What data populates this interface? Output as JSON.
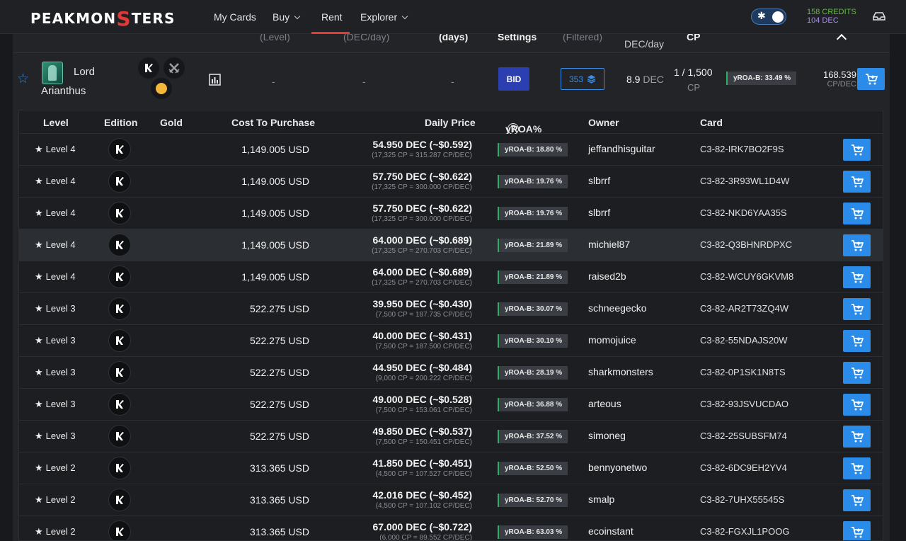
{
  "nav": {
    "logo_prefix": "PEAKMON",
    "logo_s": "S",
    "logo_suffix": "TERS",
    "items": {
      "my_cards": "My Cards",
      "buy": "Buy",
      "rent": "Rent",
      "explorer": "Explorer"
    },
    "active": "Rent",
    "credits": "158 CREDITS",
    "dec": "104 DEC",
    "accent_color": "#e53935"
  },
  "card_header": {
    "level": "(Level)",
    "dec_day": "(DEC/day)",
    "days": "(days)",
    "settings": "Settings",
    "filtered": "(Filtered)",
    "price_unit": "DEC/day",
    "cp": "CP"
  },
  "card": {
    "name_line1": "Lord",
    "name_line2": "Arianthus",
    "dash1": "-",
    "dash2": "-",
    "dash3": "-",
    "bid_label": "BID",
    "filtered_count": "353",
    "price_value": "8.9",
    "price_unit": "DEC",
    "cp_value": "1 / 1,500",
    "cp_unit": "CP",
    "yroa": "yROA-B: 33.49 %",
    "cp_dec_value": "168.539",
    "cp_dec_unit": "CP/DEC"
  },
  "table": {
    "headers": {
      "level": "Level",
      "edition": "Edition",
      "gold": "Gold",
      "cost": "Cost To Purchase",
      "daily_price": "Daily Price",
      "yroa": "yROA%",
      "yroa_help": "?",
      "owner": "Owner",
      "card": "Card"
    },
    "rows": [
      {
        "level": "Level 4",
        "cost": "1,149.005 USD",
        "price": "54.950 DEC (~$0.592)",
        "price_sub": "(17,325 CP = 315.287 CP/DEC)",
        "yroa": "yROA-B: 18.80 %",
        "owner": "jeffandhisguitar",
        "card": "C3-82-IRK7BO2F9S"
      },
      {
        "level": "Level 4",
        "cost": "1,149.005 USD",
        "price": "57.750 DEC (~$0.622)",
        "price_sub": "(17,325 CP = 300.000 CP/DEC)",
        "yroa": "yROA-B: 19.76 %",
        "owner": "slbrrf",
        "card": "C3-82-3R93WL1D4W"
      },
      {
        "level": "Level 4",
        "cost": "1,149.005 USD",
        "price": "57.750 DEC (~$0.622)",
        "price_sub": "(17,325 CP = 300.000 CP/DEC)",
        "yroa": "yROA-B: 19.76 %",
        "owner": "slbrrf",
        "card": "C3-82-NKD6YAA35S"
      },
      {
        "level": "Level 4",
        "cost": "1,149.005 USD",
        "price": "64.000 DEC (~$0.689)",
        "price_sub": "(17,325 CP = 270.703 CP/DEC)",
        "yroa": "yROA-B: 21.89 %",
        "owner": "michiel87",
        "card": "C3-82-Q3BHNRDPXC"
      },
      {
        "level": "Level 4",
        "cost": "1,149.005 USD",
        "price": "64.000 DEC (~$0.689)",
        "price_sub": "(17,325 CP = 270.703 CP/DEC)",
        "yroa": "yROA-B: 21.89 %",
        "owner": "raised2b",
        "card": "C3-82-WCUY6GKVM8"
      },
      {
        "level": "Level 3",
        "cost": "522.275 USD",
        "price": "39.950 DEC (~$0.430)",
        "price_sub": "(7,500 CP = 187.735 CP/DEC)",
        "yroa": "yROA-B: 30.07 %",
        "owner": "schneegecko",
        "card": "C3-82-AR2T73ZQ4W"
      },
      {
        "level": "Level 3",
        "cost": "522.275 USD",
        "price": "40.000 DEC (~$0.431)",
        "price_sub": "(7,500 CP = 187.500 CP/DEC)",
        "yroa": "yROA-B: 30.10 %",
        "owner": "momojuice",
        "card": "C3-82-55NDAJS20W"
      },
      {
        "level": "Level 3",
        "cost": "522.275 USD",
        "price": "44.950 DEC (~$0.484)",
        "price_sub": "(9,000 CP = 200.222 CP/DEC)",
        "yroa": "yROA-B: 28.19 %",
        "owner": "sharkmonsters",
        "card": "C3-82-0P1SK1N8TS"
      },
      {
        "level": "Level 3",
        "cost": "522.275 USD",
        "price": "49.000 DEC (~$0.528)",
        "price_sub": "(7,500 CP = 153.061 CP/DEC)",
        "yroa": "yROA-B: 36.88 %",
        "owner": "arteous",
        "card": "C3-82-93JSVUCDAO"
      },
      {
        "level": "Level 3",
        "cost": "522.275 USD",
        "price": "49.850 DEC (~$0.537)",
        "price_sub": "(7,500 CP = 150.451 CP/DEC)",
        "yroa": "yROA-B: 37.52 %",
        "owner": "simoneg",
        "card": "C3-82-25SUBSFM74"
      },
      {
        "level": "Level 2",
        "cost": "313.365 USD",
        "price": "41.850 DEC (~$0.451)",
        "price_sub": "(4,500 CP = 107.527 CP/DEC)",
        "yroa": "yROA-B: 52.50 %",
        "owner": "bennyonetwo",
        "card": "C3-82-6DC9EH2YV4"
      },
      {
        "level": "Level 2",
        "cost": "313.365 USD",
        "price": "42.016 DEC (~$0.452)",
        "price_sub": "(4,500 CP = 107.102 CP/DEC)",
        "yroa": "yROA-B: 52.70 %",
        "owner": "smalp",
        "card": "C3-82-7UHX55545S"
      },
      {
        "level": "Level 2",
        "cost": "313.365 USD",
        "price": "67.000 DEC (~$0.722)",
        "price_sub": "(6,000 CP = 89.552 CP/DEC)",
        "yroa": "yROA-B: 63.03 %",
        "owner": "ecoinstant",
        "card": "C3-82-FGXJL1POOG"
      }
    ],
    "highlighted_row": 3,
    "buy_color": "#2b8be8",
    "icons": {
      "level": "star-icon",
      "edition": "chaos-legion-edition-icon",
      "buy": "cart-icon"
    }
  }
}
